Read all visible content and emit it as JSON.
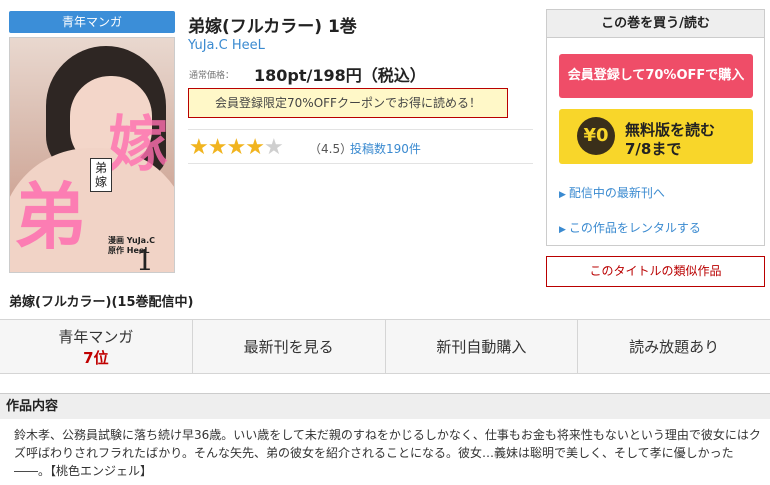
{
  "genre_badge": "青年マンガ",
  "cover": {
    "title_text": "弟嫁",
    "credit_line1": "漫画 YuJa.C",
    "credit_line2": "原作 HeeL",
    "volume": "1"
  },
  "series_label": "弟嫁(フルカラー)(15巻配信中)",
  "product": {
    "title": "弟嫁(フルカラー) 1巻",
    "author": "YuJa.C HeeL",
    "price_label": "通常価格：",
    "price": "180pt/198円（税込）",
    "coupon_text": "会員登録限定70%OFFクーポンでお得に読める！",
    "rating_stars": 4.5,
    "rating_text": "（4.5）",
    "reviews_text": "投稿数190件"
  },
  "buy_box": {
    "header": "この巻を買う/読む",
    "register_button": "会員登録して70%OFFで購入",
    "free_coin": "¥0",
    "free_line1": "無料版を読む",
    "free_line2": "7/8まで",
    "link_latest": "配信中の最新刊へ",
    "link_rental": "この作品をレンタルする"
  },
  "similar_button": "このタイトルの類似作品",
  "tabs": {
    "genre_label": "青年マンガ",
    "genre_rank": "7位",
    "latest": "最新刊を見る",
    "auto_buy": "新刊自動購入",
    "unlimited": "読み放題あり"
  },
  "section": {
    "heading": "作品内容",
    "description": "鈴木孝、公務員試験に落ち続け早36歳。いい歳をして未だ親のすねをかじるしかなく、仕事もお金も将来性もないという理由で彼女にはクズ呼ばわりされフラれたばかり。そんな矢先、弟の彼女を紹介されることになる。彼女…義妹は聡明で美しく、そして孝に優しかった――。【桃色エンジェル】"
  },
  "colors": {
    "accent_blue": "#3a8ad0",
    "register_red": "#ef4d68",
    "free_yellow": "#f8d62a",
    "star_gold": "#f1b41f",
    "rank_red": "#c00000"
  }
}
